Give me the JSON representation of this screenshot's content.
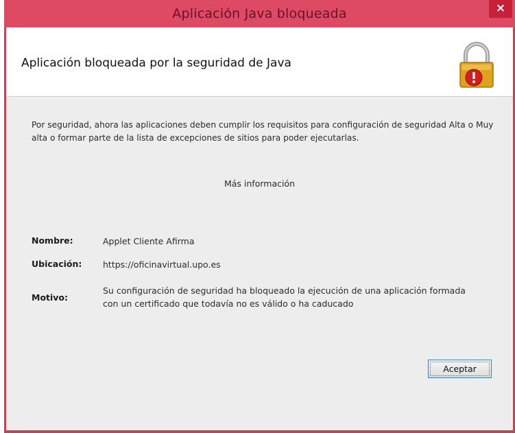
{
  "window": {
    "title": "Aplicación Java bloqueada",
    "close_symbol": "×"
  },
  "header": {
    "title": "Aplicación bloqueada por la seguridad de Java",
    "icon": "lock-warning-icon"
  },
  "message": {
    "text": "Por seguridad, ahora las aplicaciones deben cumplir los requisitos para configuración de seguridad Alta o Muy alta o formar parte de la lista de excepciones de sitios para poder ejecutarlas."
  },
  "more_info_link": "Más información",
  "details": {
    "name_label": "Nombre:",
    "name_value": "Applet Cliente Afirma",
    "location_label": "Ubicación:",
    "location_value": "https://oficinavirtual.upo.es",
    "reason_label": "Motivo:",
    "reason_value": "Su configuración de seguridad ha bloqueado la ejecución de una aplicación formada con un certificado que todavía no es válido o ha caducado"
  },
  "buttons": {
    "ok_label": "Aceptar"
  },
  "colors": {
    "titlebar": "#de4a63",
    "close_button": "#c7213a",
    "dialog_background": "#ededed",
    "lock_body": "#e0a21a",
    "warning_badge": "#d11f1f"
  }
}
